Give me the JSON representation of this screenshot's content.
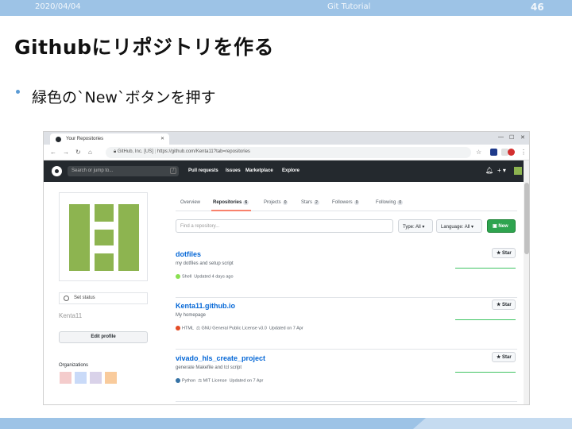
{
  "slide": {
    "date": "2020/04/04",
    "course": "Git Tutorial",
    "page_number": "46",
    "title": "Githubにリポジトリを作る",
    "bullet": "緑色の`New`ボタンを押す"
  },
  "colors": {
    "header_bar": "#9dc3e6",
    "bullet": "#5b9bd5",
    "github_dark": "#24292e",
    "new_button": "#2ea44f",
    "avatar_green": "#8db450"
  },
  "browser": {
    "tab_title": "Your Repositories",
    "url_site": "GitHub, Inc. [US]",
    "url": "https://github.com/Kenta11?tab=repositories"
  },
  "github": {
    "search_placeholder": "Search or jump to...",
    "search_key": "/",
    "nav": [
      "Pull requests",
      "Issues",
      "Marketplace",
      "Explore"
    ],
    "bell_icon": "bell-icon",
    "plus_label": "+ ▾",
    "profile": {
      "status_label": "Set status",
      "username": "Kenta11",
      "edit_profile": "Edit profile",
      "organizations_label": "Organizations"
    },
    "profile_tabs": [
      {
        "label": "Overview",
        "count": ""
      },
      {
        "label": "Repositories",
        "count": "6"
      },
      {
        "label": "Projects",
        "count": "0"
      },
      {
        "label": "Stars",
        "count": "2"
      },
      {
        "label": "Followers",
        "count": "0"
      },
      {
        "label": "Following",
        "count": "0"
      }
    ],
    "find_placeholder": "Find a repository...",
    "type_filter": "Type: All ▾",
    "language_filter": "Language: All ▾",
    "new_button": "New",
    "star_label": "★ Star",
    "repos": [
      {
        "name": "dotfiles",
        "description": "my dotfiles and setup script",
        "language": "Shell",
        "language_color": "#89e051",
        "license": "",
        "updated": "Updated 4 days ago"
      },
      {
        "name": "Kenta11.github.io",
        "description": "My homepage",
        "language": "HTML",
        "language_color": "#e34c26",
        "license": "GNU General Public License v3.0",
        "updated": "Updated on 7 Apr"
      },
      {
        "name": "vivado_hls_create_project",
        "description": "generate Makefile and tcl script",
        "language": "Python",
        "language_color": "#3572A5",
        "license": "MIT License",
        "updated": "Updated on 7 Apr"
      }
    ]
  }
}
